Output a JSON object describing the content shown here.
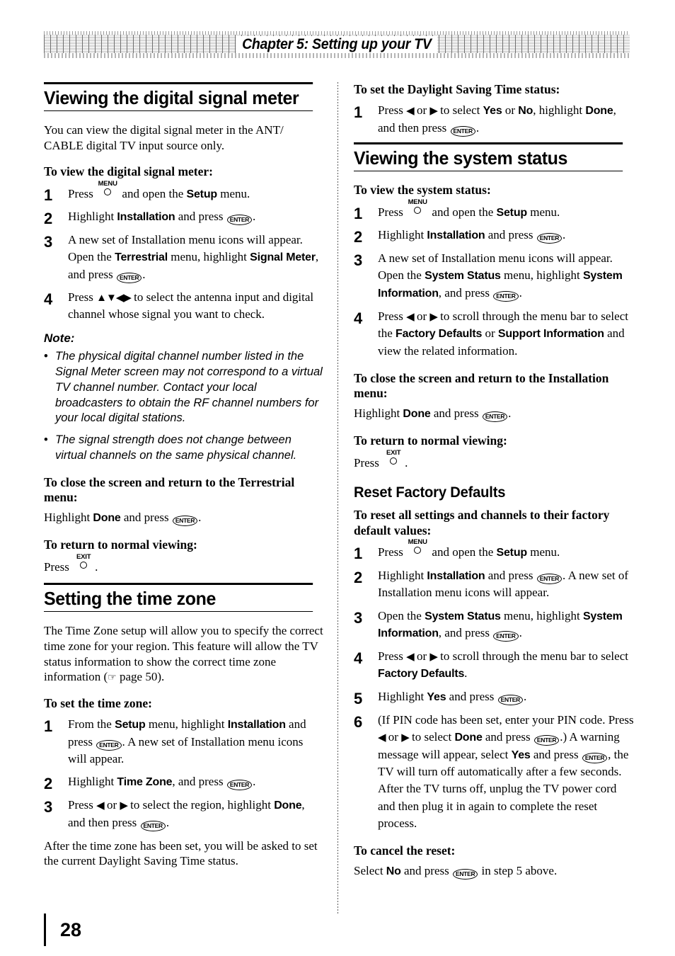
{
  "header": {
    "chapter_title": "Chapter 5: Setting up your TV"
  },
  "footer": {
    "page_number": "28"
  },
  "keys": {
    "menu_label": "MENU",
    "exit_label": "EXIT",
    "enter_label": "ENTER"
  },
  "left_column": {
    "heading_signal_meter": "Viewing the digital signal meter",
    "intro_signal_meter": "You can view the digital signal meter in the ANT/ CABLE digital TV input source only.",
    "proc_view_meter": "To view the digital signal meter:",
    "steps_view_meter": {
      "n1": "1",
      "s1_a": "Press ",
      "s1_b": " and open the ",
      "s1_setup": "Setup",
      "s1_c": " menu.",
      "n2": "2",
      "s2_a": "Highlight ",
      "s2_installation": "Installation",
      "s2_b": " and press ",
      "s2_c": ".",
      "n3": "3",
      "s3_a": "A new set of Installation menu icons will appear. Open the ",
      "s3_terrestrial": "Terrestrial",
      "s3_b": " menu, highlight ",
      "s3_signal_meter": "Signal Meter",
      "s3_c": ", and press ",
      "s3_d": ".",
      "n4": "4",
      "s4_a": "Press ",
      "s4_arrows": "▲▼◀▶",
      "s4_b": " to select the antenna input and digital channel whose signal you want to check."
    },
    "note_label": "Note:",
    "note_items": [
      "The physical digital channel number listed in the Signal Meter screen may not correspond to a virtual TV channel number. Contact your local broadcasters to obtain the RF channel numbers for your local digital stations.",
      "The signal strength does not change between virtual channels on the same physical channel."
    ],
    "proc_close_terrestrial": "To close the screen and return to the Terrestrial menu:",
    "close_terrestrial_body": {
      "a": "Highlight ",
      "done": "Done",
      "b": " and press ",
      "c": "."
    },
    "proc_return_normal": "To return to normal viewing:",
    "return_normal_body": {
      "a": "Press ",
      "b": "."
    },
    "heading_time_zone": "Setting the time zone",
    "intro_time_zone_a": "The Time Zone setup will allow you to specify the correct time zone for your region. This feature will allow the TV status information to show the correct time zone information (",
    "intro_time_zone_hand": "☞",
    "intro_time_zone_b": " page 50).",
    "proc_set_time_zone": "To set the time zone:",
    "steps_time_zone": {
      "n1": "1",
      "s1_a": "From the ",
      "s1_setup": "Setup",
      "s1_b": " menu, highlight ",
      "s1_installation": "Installation",
      "s1_c": " and press ",
      "s1_d": ". A new set of Installation menu icons will appear.",
      "n2": "2",
      "s2_a": "Highlight ",
      "s2_time_zone": "Time Zone",
      "s2_b": ", and press ",
      "s2_c": ".",
      "n3": "3",
      "s3_a": "Press ",
      "s3_left": "◀",
      "s3_or": " or ",
      "s3_right": "▶",
      "s3_b": " to select the region, highlight ",
      "s3_done": "Done",
      "s3_c": ", and then press ",
      "s3_d": "."
    },
    "outro_time_zone": "After the time zone has been set, you will be asked to set the current Daylight Saving Time status."
  },
  "right_column": {
    "proc_dst": "To set the Daylight Saving Time status:",
    "steps_dst": {
      "n1": "1",
      "s1_a": "Press ",
      "s1_left": "◀",
      "s1_or": " or ",
      "s1_right": "▶",
      "s1_b": " to select ",
      "s1_yes": "Yes",
      "s1_c": " or ",
      "s1_no": "No",
      "s1_d": ", highlight ",
      "s1_done": "Done",
      "s1_e": ", and then press ",
      "s1_f": "."
    },
    "heading_system_status": "Viewing the system status",
    "proc_view_status": "To view the system status:",
    "steps_view_status": {
      "n1": "1",
      "s1_a": "Press ",
      "s1_b": " and open the ",
      "s1_setup": "Setup",
      "s1_c": " menu.",
      "n2": "2",
      "s2_a": "Highlight ",
      "s2_installation": "Installation",
      "s2_b": " and press ",
      "s2_c": ".",
      "n3": "3",
      "s3_a": "A new set of Installation menu icons will appear. Open the ",
      "s3_system_status": "System Status",
      "s3_b": " menu, highlight ",
      "s3_system_info": "System Information",
      "s3_c": ", and press ",
      "s3_d": ".",
      "n4": "4",
      "s4_a": "Press ",
      "s4_left": "◀",
      "s4_or": " or ",
      "s4_right": "▶",
      "s4_b": " to scroll through the menu bar to select the ",
      "s4_factory_defaults": "Factory Defaults",
      "s4_c": " or ",
      "s4_support_info": "Support Information",
      "s4_d": " and view the related information."
    },
    "proc_close_installation": "To close the screen and return to the Installation menu:",
    "close_installation_body": {
      "a": "Highlight ",
      "done": "Done",
      "b": " and press ",
      "c": "."
    },
    "proc_return_normal": "To return to normal viewing:",
    "return_normal_body": {
      "a": "Press ",
      "b": "."
    },
    "heading_reset_factory": "Reset Factory Defaults",
    "proc_reset_all": "To reset all settings and channels to their factory default values:",
    "steps_reset": {
      "n1": "1",
      "s1_a": "Press ",
      "s1_b": " and open the ",
      "s1_setup": "Setup",
      "s1_c": " menu.",
      "n2": "2",
      "s2_a": "Highlight ",
      "s2_installation": "Installation",
      "s2_b": " and press ",
      "s2_c": ". A new set of Installation menu icons will appear.",
      "n3": "3",
      "s3_a": "Open the ",
      "s3_system_status": "System Status",
      "s3_b": " menu, highlight ",
      "s3_system_info": "System Information",
      "s3_c": ", and press ",
      "s3_d": ".",
      "n4": "4",
      "s4_a": "Press ",
      "s4_left": "◀",
      "s4_or": " or ",
      "s4_right": "▶",
      "s4_b": " to scroll through the menu bar to select ",
      "s4_factory_defaults": "Factory Defaults",
      "s4_c": ".",
      "n5": "5",
      "s5_a": "Highlight ",
      "s5_yes": "Yes",
      "s5_b": " and press ",
      "s5_c": ".",
      "n6": "6",
      "s6_a": "(If PIN code has been set, enter your PIN code. Press ",
      "s6_left": "◀",
      "s6_or": " or ",
      "s6_right": "▶",
      "s6_b": " to select ",
      "s6_done": "Done",
      "s6_c": " and press ",
      "s6_d": ".) A warning message will appear, select ",
      "s6_yes": "Yes",
      "s6_e": " and press ",
      "s6_f": ", the TV will turn off automatically after a few seconds. After the TV turns off, unplug the TV power cord and then plug it in again to complete the reset process."
    },
    "proc_cancel_reset": "To cancel the reset:",
    "cancel_reset_body": {
      "a": "Select ",
      "no": "No",
      "b": " and press ",
      "c": " in step 5 above."
    }
  }
}
